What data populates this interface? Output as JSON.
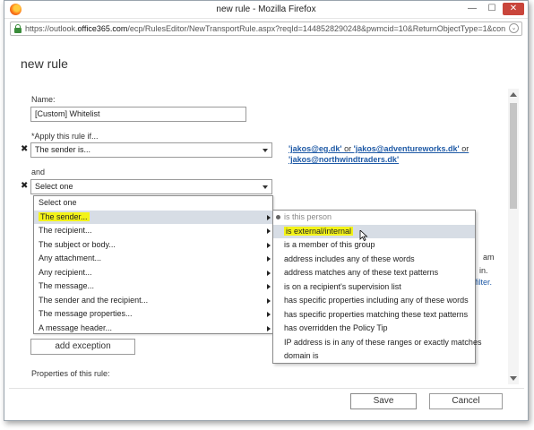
{
  "window": {
    "title": "new rule - Mozilla Firefox",
    "minimize": "—",
    "maximize": "☐",
    "close": "✕"
  },
  "address_bar": {
    "url_prefix": "https://outlook.",
    "url_domain": "office365.com",
    "url_suffix": "/ecp/RulesEditor/NewTransportRule.aspx?reqId=1448528290248&pwmcid=10&ReturnObjectType=1&con"
  },
  "page": {
    "heading": "new rule"
  },
  "form": {
    "name_label": "Name:",
    "name_value": "[Custom] Whitelist",
    "apply_label": "*Apply this rule if...",
    "condition_value": "The sender is...",
    "condition_link_1": "'jakos@eg.dk'",
    "condition_link_or1": " or ",
    "condition_link_2": "'jakos@adventureworks.dk'",
    "condition_link_or2": " or",
    "condition_link_3": "'jakos@northwindtraders.dk'",
    "and_label": "and",
    "second_condition_value": "Select one",
    "remove_icon": "✖",
    "add_exception_label": "add exception",
    "properties_label": "Properties of this rule:"
  },
  "dropdown": {
    "items": [
      {
        "label": "Select one",
        "has_sub": false
      },
      {
        "label": "The sender...",
        "has_sub": true
      },
      {
        "label": "The recipient...",
        "has_sub": true
      },
      {
        "label": "The subject or body...",
        "has_sub": true
      },
      {
        "label": "Any attachment...",
        "has_sub": true
      },
      {
        "label": "Any recipient...",
        "has_sub": true
      },
      {
        "label": "The message...",
        "has_sub": true
      },
      {
        "label": "The sender and the recipient...",
        "has_sub": true
      },
      {
        "label": "The message properties...",
        "has_sub": true
      },
      {
        "label": "A message header...",
        "has_sub": true
      }
    ],
    "selected_index": 1
  },
  "submenu": {
    "items": [
      "is this person",
      "is external/internal",
      "is a member of this group",
      "address includes any of these words",
      "address matches any of these text patterns",
      "is on a recipient's supervision list",
      "has specific properties including any of these words",
      "has specific properties matching these text patterns",
      "has overridden the Policy Tip",
      "IP address is in any of these ranges or exactly matches",
      "domain is"
    ],
    "selected_index": 1
  },
  "background_text": {
    "frag_1": "am",
    "frag_2": "in.",
    "frag_3": "filter."
  },
  "buttons": {
    "save": "Save",
    "cancel": "Cancel"
  },
  "colors": {
    "highlight": "#f3f317",
    "link": "#1f5aa6",
    "selected_row": "#d7dde5"
  }
}
